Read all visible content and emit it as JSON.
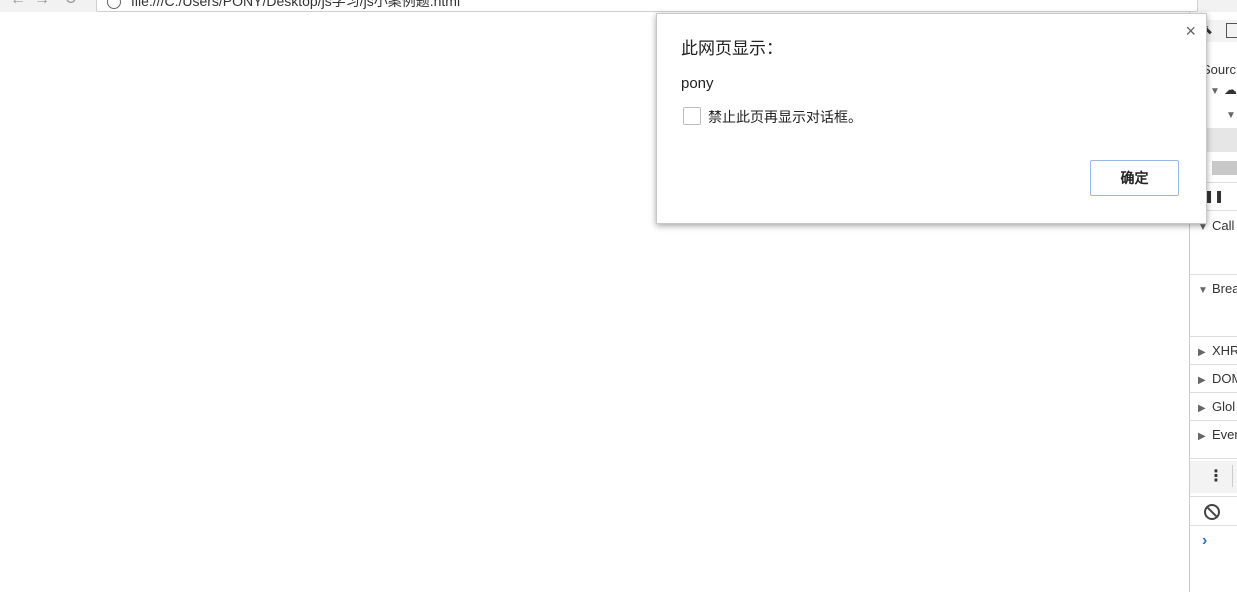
{
  "browser": {
    "nav": {
      "back": "←",
      "forward": "→",
      "reload": "↻"
    },
    "url": "file:///C:/Users/PONY/Desktop/js学习/js小案例题.html"
  },
  "devtools": {
    "tab_sources": "Sourc",
    "panels": {
      "call_stack": "Call",
      "breakpoints": "Brea",
      "xhr": "XHR",
      "dom": "DOM",
      "global": "Glol",
      "event": "Ever"
    },
    "console_prompt": "›"
  },
  "dialog": {
    "title": "此网页显示：",
    "message": "pony",
    "checkbox_label": "禁止此页再显示对话框。",
    "ok_label": "确定",
    "close_label": "×"
  }
}
